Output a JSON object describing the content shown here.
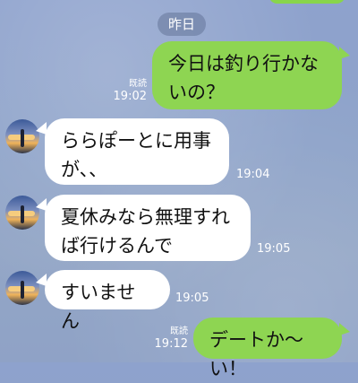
{
  "date_separator": "昨日",
  "messages": [
    {
      "side": "out",
      "text": "今日は釣り行かないの？",
      "read": "既読",
      "time": "19:02"
    },
    {
      "side": "in",
      "text": "ららぽーとに用事が、、",
      "time": "19:04"
    },
    {
      "side": "in",
      "text": "夏休みなら無理すれば行けるんで",
      "time": "19:05"
    },
    {
      "side": "in",
      "text": "すいません",
      "time": "19:05"
    },
    {
      "side": "out",
      "text": "デートか〜い！",
      "read": "既読",
      "time": "19:12"
    }
  ],
  "colors": {
    "outgoing_bubble": "#8ed552",
    "incoming_bubble": "#ffffff",
    "background": "#8fa2c6"
  }
}
